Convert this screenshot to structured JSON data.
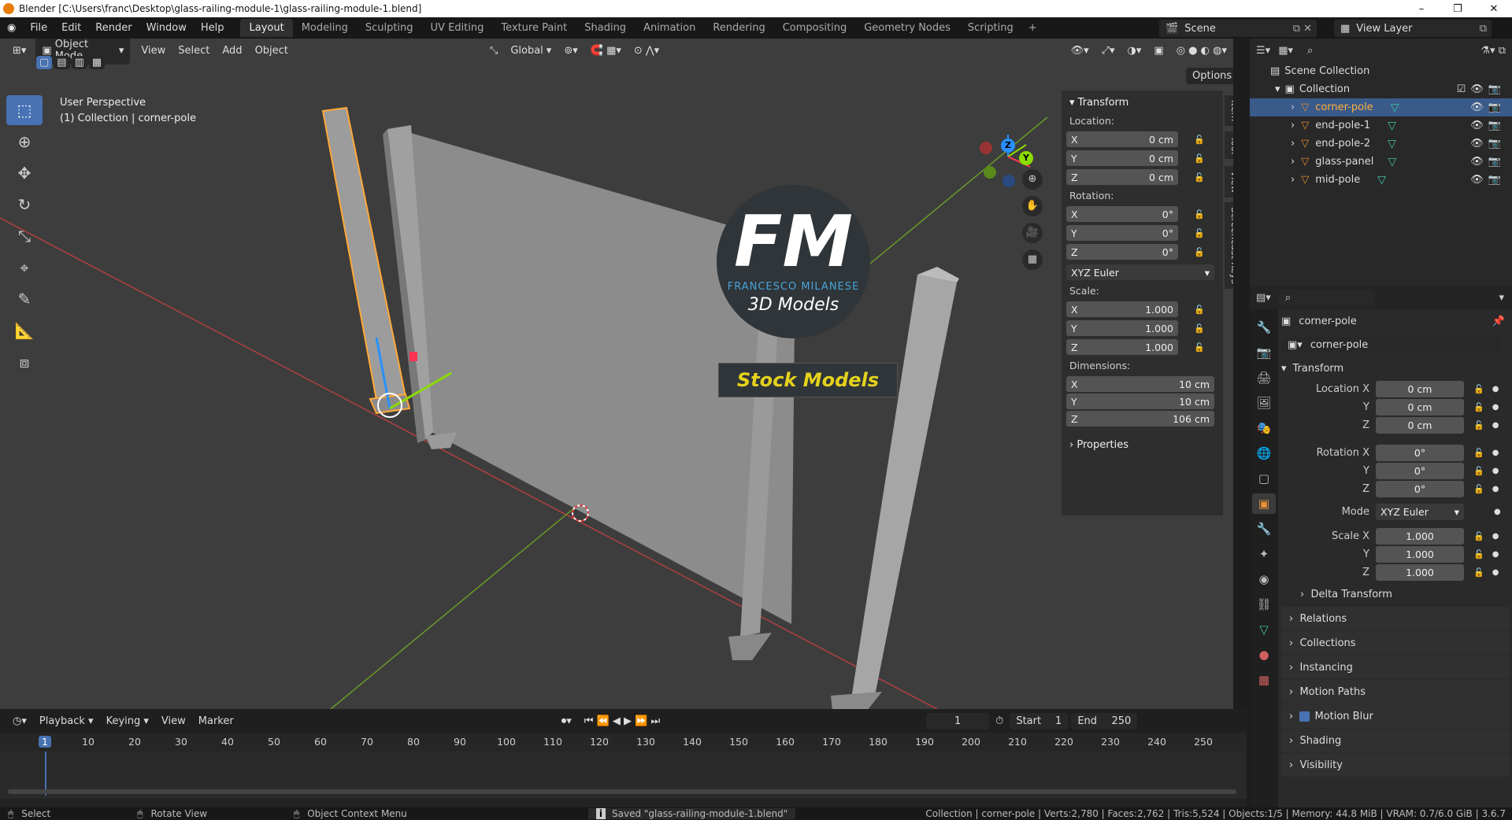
{
  "window": {
    "title": "Blender [C:\\Users\\franc\\Desktop\\glass-railing-module-1\\glass-railing-module-1.blend]",
    "controls": [
      "–",
      "❐",
      "✕"
    ]
  },
  "menus": [
    "File",
    "Edit",
    "Render",
    "Window",
    "Help"
  ],
  "workspaces": [
    "Layout",
    "Modeling",
    "Sculpting",
    "UV Editing",
    "Texture Paint",
    "Shading",
    "Animation",
    "Rendering",
    "Compositing",
    "Geometry Nodes",
    "Scripting"
  ],
  "active_workspace": "Layout",
  "scene_name": "Scene",
  "view_layer": "View Layer",
  "viewport": {
    "mode": "Object Mode",
    "menus": [
      "View",
      "Select",
      "Add",
      "Object"
    ],
    "orientation": "Global",
    "options_label": "Options",
    "info_line1": "User Perspective",
    "info_line2": "(1) Collection | corner-pole",
    "watermark": {
      "logo": "FM",
      "brand": "FRANCESCO MILANESE",
      "tagline": "3D Models",
      "banner": "Stock Models"
    },
    "gizmo_axes": [
      "Z",
      "Y",
      "X"
    ]
  },
  "npanel": {
    "section": "Transform",
    "location_label": "Location:",
    "location": [
      {
        "axis": "X",
        "value": "0 cm"
      },
      {
        "axis": "Y",
        "value": "0 cm"
      },
      {
        "axis": "Z",
        "value": "0 cm"
      }
    ],
    "rotation_label": "Rotation:",
    "rotation": [
      {
        "axis": "X",
        "value": "0°"
      },
      {
        "axis": "Y",
        "value": "0°"
      },
      {
        "axis": "Z",
        "value": "0°"
      }
    ],
    "rotation_mode": "XYZ Euler",
    "scale_label": "Scale:",
    "scale": [
      {
        "axis": "X",
        "value": "1.000"
      },
      {
        "axis": "Y",
        "value": "1.000"
      },
      {
        "axis": "Z",
        "value": "1.000"
      }
    ],
    "dimensions_label": "Dimensions:",
    "dimensions": [
      {
        "axis": "X",
        "value": "10 cm"
      },
      {
        "axis": "Y",
        "value": "10 cm"
      },
      {
        "axis": "Z",
        "value": "106 cm"
      }
    ],
    "properties_label": "Properties",
    "tabs": [
      "Item",
      "Tool",
      "View",
      "Screencast Keys"
    ]
  },
  "outliner": {
    "root": "Scene Collection",
    "collection": "Collection",
    "objects": [
      "corner-pole",
      "end-pole-1",
      "end-pole-2",
      "glass-panel",
      "mid-pole"
    ],
    "selected": "corner-pole"
  },
  "properties": {
    "object_name": "corner-pole",
    "datablock": "corner-pole",
    "transform_label": "Transform",
    "location": [
      {
        "label": "Location X",
        "value": "0 cm"
      },
      {
        "label": "Y",
        "value": "0 cm"
      },
      {
        "label": "Z",
        "value": "0 cm"
      }
    ],
    "rotation": [
      {
        "label": "Rotation X",
        "value": "0°"
      },
      {
        "label": "Y",
        "value": "0°"
      },
      {
        "label": "Z",
        "value": "0°"
      }
    ],
    "mode_label": "Mode",
    "mode_value": "XYZ Euler",
    "scale": [
      {
        "label": "Scale X",
        "value": "1.000"
      },
      {
        "label": "Y",
        "value": "1.000"
      },
      {
        "label": "Z",
        "value": "1.000"
      }
    ],
    "subsections": [
      "Delta Transform",
      "Relations",
      "Collections",
      "Instancing",
      "Motion Paths",
      "Motion Blur",
      "Shading",
      "Visibility"
    ]
  },
  "timeline": {
    "menus": [
      "Playback",
      "Keying",
      "View",
      "Marker"
    ],
    "current_frame": "1",
    "start_label": "Start",
    "start": "1",
    "end_label": "End",
    "end": "250",
    "ruler": [
      "1",
      "10",
      "20",
      "30",
      "40",
      "50",
      "60",
      "70",
      "80",
      "90",
      "100",
      "110",
      "120",
      "130",
      "140",
      "150",
      "160",
      "170",
      "180",
      "190",
      "200",
      "210",
      "220",
      "230",
      "240",
      "250"
    ]
  },
  "statusbar": {
    "select": "Select",
    "rotate": "Rotate View",
    "context": "Object Context Menu",
    "message": "Saved \"glass-railing-module-1.blend\"",
    "stats": "Collection | corner-pole | Verts:2,780 | Faces:2,762 | Tris:5,524 | Objects:1/5 | Memory: 44.8 MiB | VRAM: 0.7/6.0 GiB | 3.6.7"
  },
  "colors": {
    "accent": "#4772b3",
    "selection": "#ffa938",
    "x_axis": "#ff3352",
    "y_axis": "#8bdc00",
    "z_axis": "#2890ff"
  }
}
